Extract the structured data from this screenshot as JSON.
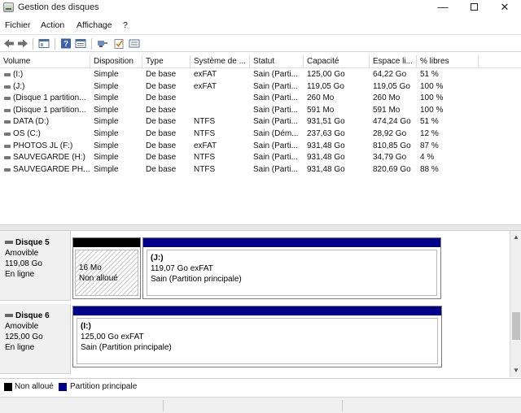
{
  "window": {
    "title": "Gestion des disques",
    "minimize_glyph": "—",
    "close_glyph": "✕"
  },
  "menu": [
    "Fichier",
    "Action",
    "Affichage",
    "?"
  ],
  "toolbar_icons": [
    "back-arrow-icon",
    "forward-arrow-icon",
    "console-tree-icon",
    "help-icon",
    "properties-icon",
    "connect-icon",
    "check-icon",
    "disk-list-icon"
  ],
  "table": {
    "columns": [
      "Volume",
      "Disposition",
      "Type",
      "Système de ...",
      "Statut",
      "Capacité",
      "Espace li...",
      "% libres"
    ],
    "rows": [
      [
        "(I:)",
        "Simple",
        "De base",
        "exFAT",
        "Sain (Parti...",
        "125,00 Go",
        "64,22 Go",
        "51 %"
      ],
      [
        "(J:)",
        "Simple",
        "De base",
        "exFAT",
        "Sain (Parti...",
        "119,05 Go",
        "119,05 Go",
        "100 %"
      ],
      [
        "(Disque 1 partition...",
        "Simple",
        "De base",
        "",
        "Sain (Parti...",
        "260 Mo",
        "260 Mo",
        "100 %"
      ],
      [
        "(Disque 1 partition...",
        "Simple",
        "De base",
        "",
        "Sain (Parti...",
        "591 Mo",
        "591 Mo",
        "100 %"
      ],
      [
        "DATA (D:)",
        "Simple",
        "De base",
        "NTFS",
        "Sain (Parti...",
        "931,51 Go",
        "474,24 Go",
        "51 %"
      ],
      [
        "OS (C:)",
        "Simple",
        "De base",
        "NTFS",
        "Sain (Dém...",
        "237,63 Go",
        "28,92 Go",
        "12 %"
      ],
      [
        "PHOTOS JL (F:)",
        "Simple",
        "De base",
        "exFAT",
        "Sain (Parti...",
        "931,48 Go",
        "810,85 Go",
        "87 %"
      ],
      [
        "SAUVEGARDE (H:)",
        "Simple",
        "De base",
        "NTFS",
        "Sain (Parti...",
        "931,48 Go",
        "34,79 Go",
        "4 %"
      ],
      [
        "SAUVEGARDE PH...",
        "Simple",
        "De base",
        "NTFS",
        "Sain (Parti...",
        "931,48 Go",
        "820,69 Go",
        "88 %"
      ]
    ]
  },
  "disks": [
    {
      "name": "Disque 5",
      "kind": "Amovible",
      "size": "119,08 Go",
      "state": "En ligne",
      "unallocated": {
        "size": "16 Mo",
        "label": "Non alloué"
      },
      "partition": {
        "title": "(J:)",
        "detail": "119,07 Go exFAT",
        "status": "Sain (Partition principale)"
      }
    },
    {
      "name": "Disque 6",
      "kind": "Amovible",
      "size": "125,00 Go",
      "state": "En ligne",
      "partition": {
        "title": "(I:)",
        "detail": "125,00 Go exFAT",
        "status": "Sain (Partition principale)"
      }
    }
  ],
  "legend": {
    "unallocated": "Non alloué",
    "primary": "Partition principale",
    "colors": {
      "unallocated": "#000000",
      "primary": "#00008b"
    }
  }
}
